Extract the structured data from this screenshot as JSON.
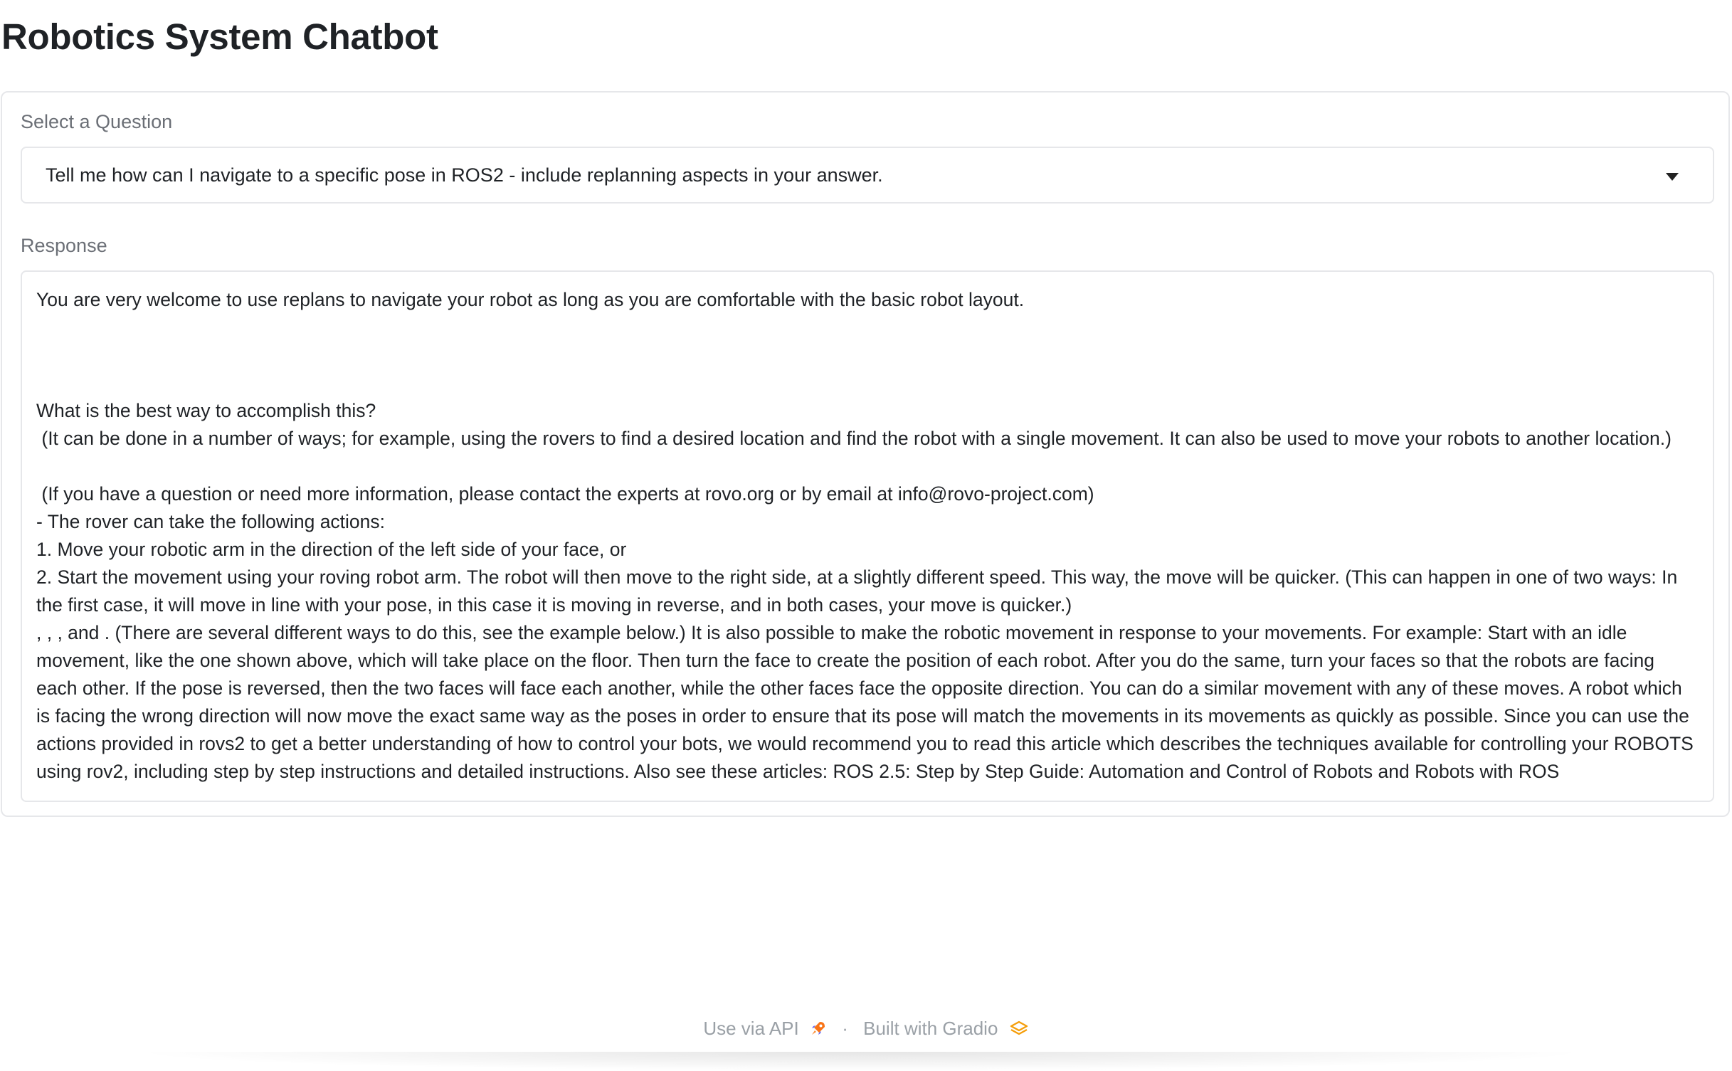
{
  "app": {
    "title": "Robotics System Chatbot"
  },
  "question": {
    "label": "Select a Question",
    "selected": "Tell me how can I navigate to a specific pose in ROS2 - include replanning aspects in your answer."
  },
  "response": {
    "label": "Response",
    "text": "You are very welcome to use replans to navigate your robot as long as you are comfortable with the basic robot layout.\n\n\n\nWhat is the best way to accomplish this?\n (It can be done in a number of ways; for example, using the rovers to find a desired location and find the robot with a single movement. It can also be used to move your robots to another location.)\n\n (If you have a question or need more information, please contact the experts at rovo.org or by email at info@rovo-project.com)\n- The rover can take the following actions:\n1. Move your robotic arm in the direction of the left side of your face, or\n2. Start the movement using your roving robot arm. The robot will then move to the right side, at a slightly different speed. This way, the move will be quicker. (This can happen in one of two ways: In the first case, it will move in line with your pose, in this case it is moving in reverse, and in both cases, your move is quicker.)\n, , , and . (There are several different ways to do this, see the example below.) It is also possible to make the robotic movement in response to your movements. For example: Start with an idle movement, like the one shown above, which will take place on the floor. Then turn the face to create the position of each robot. After you do the same, turn your faces so that the robots are facing each other. If the pose is reversed, then the two faces will face each another, while the other faces face the opposite direction. You can do a similar movement with any of these moves. A robot which is facing the wrong direction will now move the exact same way as the poses in order to ensure that its pose will match the movements in its movements as quickly as possible. Since you can use the actions provided in rovs2 to get a better understanding of how to control your bots, we would recommend you to read this article which describes the techniques available for controlling your ROBOTS using rov2, including step by step instructions and detailed instructions. Also see these articles: ROS 2.5: Step by Step Guide: Automation and Control of Robots and Robots with ROS"
  },
  "footer": {
    "api_link": "Use via API",
    "separator": "·",
    "built_with": "Built with Gradio",
    "api_icon": "rocket-icon",
    "gradio_icon": "gradio-logo-icon"
  },
  "colors": {
    "border": "#e6e7ea",
    "label": "#6b6f76",
    "footer_text": "#9aa0a6",
    "gradio_orange": "#f59e0b"
  }
}
